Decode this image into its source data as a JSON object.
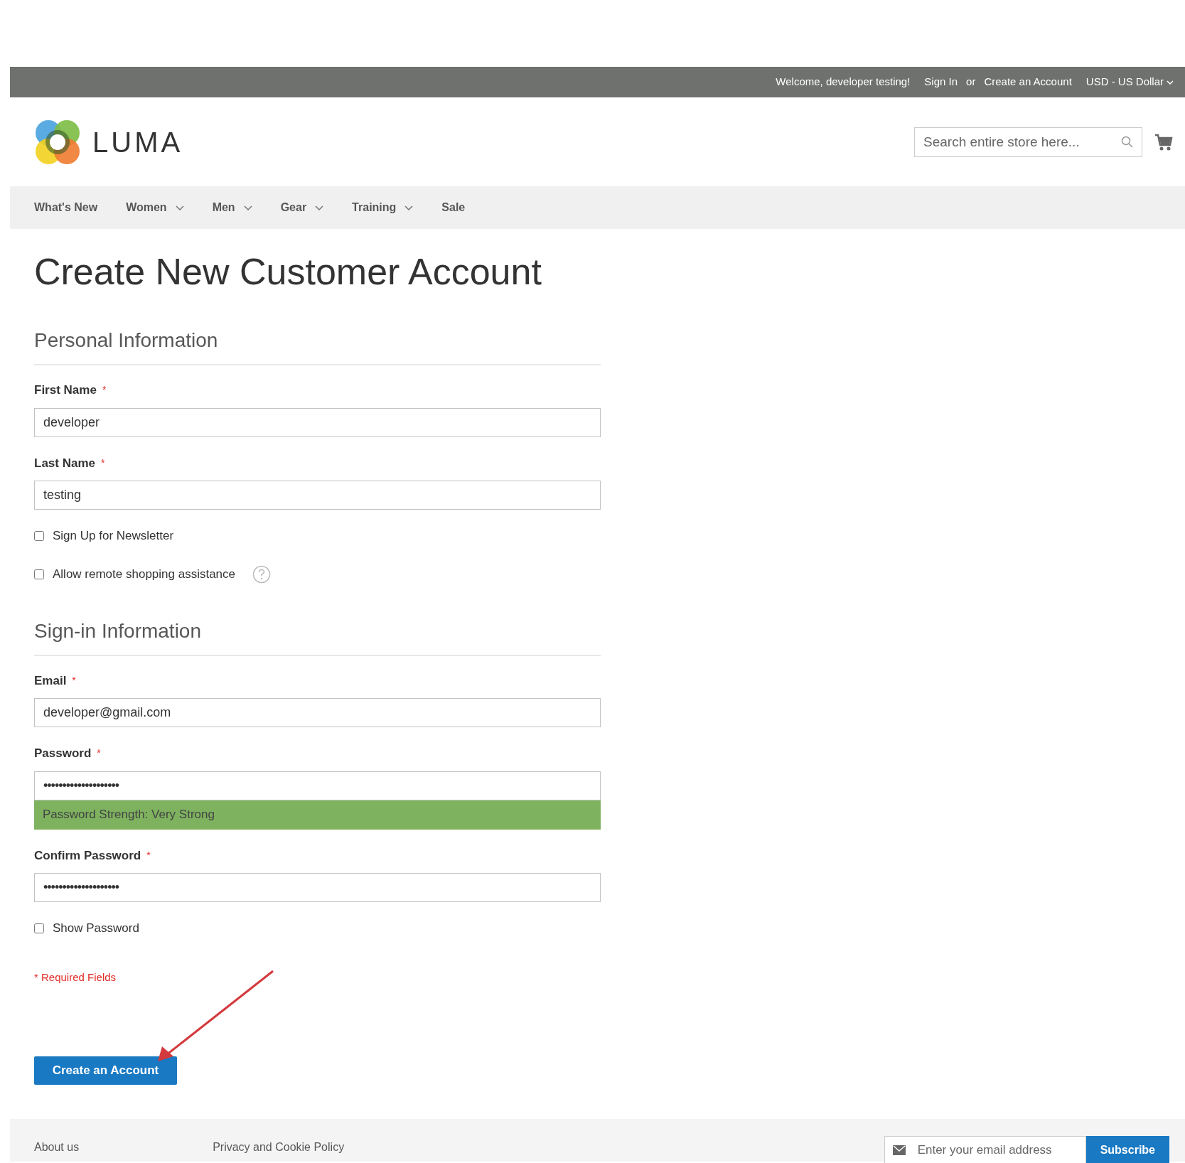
{
  "top_bar": {
    "welcome": "Welcome, developer testing!",
    "links": [
      "Sign In",
      "or",
      "Create an Account"
    ],
    "currency": "USD - US Dollar"
  },
  "header": {
    "logo_text": "LUMA",
    "search": {
      "placeholder": "Search entire store here..."
    }
  },
  "nav": [
    {
      "label": "What's New",
      "dropdown": false
    },
    {
      "label": "Women",
      "dropdown": true
    },
    {
      "label": "Men",
      "dropdown": true
    },
    {
      "label": "Gear",
      "dropdown": true
    },
    {
      "label": "Training",
      "dropdown": true
    },
    {
      "label": "Sale",
      "dropdown": false
    }
  ],
  "page_title": "Create New Customer Account",
  "sections": [
    {
      "title": "Personal Information",
      "fields": [
        {
          "kind": "text",
          "label": "First Name",
          "required_mark": "*",
          "value": "developer"
        },
        {
          "kind": "text",
          "label": "Last Name",
          "required_mark": "*",
          "value": "testing"
        },
        {
          "kind": "checkbox",
          "label": "Sign Up for Newsletter",
          "checked": false
        },
        {
          "kind": "checkbox",
          "label": "Allow remote shopping assistance",
          "checked": false,
          "help": true
        }
      ]
    },
    {
      "title": "Sign-in Information",
      "fields": [
        {
          "kind": "text",
          "label": "Email",
          "required_mark": "*",
          "value": "developer@gmail.com"
        },
        {
          "kind": "password",
          "label": "Password",
          "required_mark": "*",
          "value": "••••••••••••••••••••",
          "strength": "Password Strength: Very Strong"
        },
        {
          "kind": "password",
          "label": "Confirm Password",
          "required_mark": "*",
          "value": "••••••••••••••••••••"
        },
        {
          "kind": "checkbox",
          "label": "Show Password",
          "checked": false
        }
      ]
    }
  ],
  "required_note": "* Required Fields",
  "submit_button": "Create an Account",
  "footer": {
    "links": [
      "About us",
      "Privacy and Cookie Policy"
    ],
    "newsletter": {
      "placeholder": "Enter your email address",
      "button": "Subscribe"
    }
  }
}
